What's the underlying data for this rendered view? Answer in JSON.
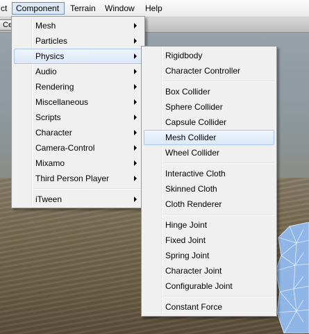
{
  "menubar": {
    "items": [
      {
        "label": "ct"
      },
      {
        "label": "Component"
      },
      {
        "label": "Terrain"
      },
      {
        "label": "Window"
      },
      {
        "label": "Help"
      }
    ]
  },
  "toolbar": {
    "button_label": "Ce"
  },
  "component_menu": {
    "items": [
      {
        "label": "Mesh"
      },
      {
        "label": "Particles"
      },
      {
        "label": "Physics"
      },
      {
        "label": "Audio"
      },
      {
        "label": "Rendering"
      },
      {
        "label": "Miscellaneous"
      },
      {
        "label": "Scripts"
      },
      {
        "label": "Character"
      },
      {
        "label": "Camera-Control"
      },
      {
        "label": "Mixamo"
      },
      {
        "label": "Third Person Player"
      },
      {
        "label": "iTween"
      }
    ]
  },
  "physics_submenu": {
    "items": [
      {
        "label": "Rigidbody"
      },
      {
        "label": "Character Controller"
      },
      {
        "label": "Box Collider"
      },
      {
        "label": "Sphere Collider"
      },
      {
        "label": "Capsule Collider"
      },
      {
        "label": "Mesh Collider"
      },
      {
        "label": "Wheel Collider"
      },
      {
        "label": "Interactive Cloth"
      },
      {
        "label": "Skinned Cloth"
      },
      {
        "label": "Cloth Renderer"
      },
      {
        "label": "Hinge Joint"
      },
      {
        "label": "Fixed Joint"
      },
      {
        "label": "Spring Joint"
      },
      {
        "label": "Character Joint"
      },
      {
        "label": "Configurable Joint"
      },
      {
        "label": "Constant Force"
      }
    ]
  },
  "colors": {
    "menu_background": "#f0f0f0",
    "highlight_fill": "#dce9f8",
    "highlight_border": "#a8c5ea",
    "menubar_active_border": "#6f8eb1"
  }
}
